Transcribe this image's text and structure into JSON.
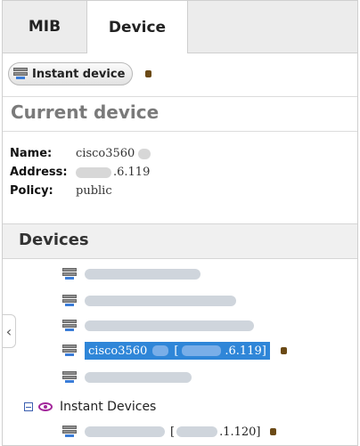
{
  "tabs": [
    {
      "label": "MIB",
      "active": false
    },
    {
      "label": "Device",
      "active": true
    }
  ],
  "toolbar": {
    "instant_device_label": "Instant device"
  },
  "current_device": {
    "title": "Current device",
    "fields": [
      {
        "label": "Name:",
        "value": "cisco3560"
      },
      {
        "label": "Address:",
        "value": ".6.119"
      },
      {
        "label": "Policy:",
        "value": "public"
      }
    ]
  },
  "devices": {
    "title": "Devices",
    "selected": {
      "name": "cisco3560",
      "bracket_open": "[",
      "address_suffix": ".6.119]"
    },
    "instant_group": {
      "label": "Instant Devices",
      "item_address_open": "[",
      "item_address_suffix": ".1.120]"
    }
  },
  "colors": {
    "selection": "#2f86d8",
    "group_icon": "#a3269b"
  }
}
